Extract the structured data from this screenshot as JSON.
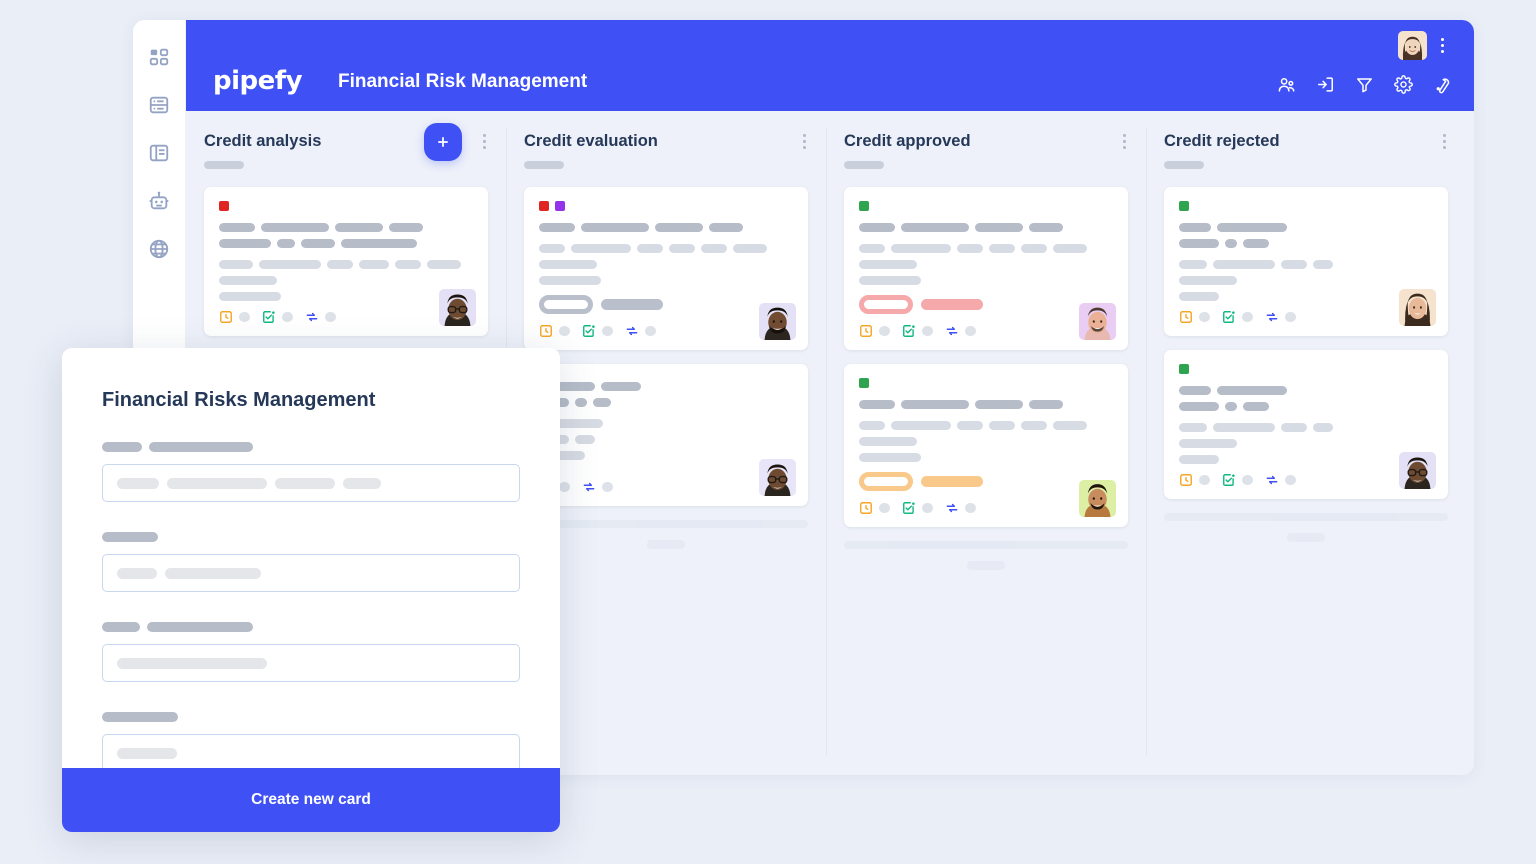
{
  "app": {
    "logo_text": "pipefy",
    "board_title": "Financial Risk Management",
    "accent_color": "#3f51f5",
    "background_color": "#eaeef7",
    "board_background": "#eef1f9"
  },
  "sidebar": {
    "items": [
      {
        "icon": "apps-grid-icon",
        "label": "Apps"
      },
      {
        "icon": "database-icon",
        "label": "Database"
      },
      {
        "icon": "layout-panel-icon",
        "label": "Layout"
      },
      {
        "icon": "robot-automation-icon",
        "label": "Automations"
      },
      {
        "icon": "globe-icon",
        "label": "Portals"
      }
    ]
  },
  "topbar": {
    "avatar": {
      "name": "user-avatar",
      "skin": "#f0d5bd",
      "hair": "#4a3326",
      "bg": "#f6e3cd"
    },
    "kebab": "more-options",
    "actions": [
      {
        "icon": "members-icon",
        "label": "Members"
      },
      {
        "icon": "import-icon",
        "label": "Import"
      },
      {
        "icon": "filter-icon",
        "label": "Filter"
      },
      {
        "icon": "settings-gear-icon",
        "label": "Settings"
      },
      {
        "icon": "wrench-icon",
        "label": "Tools"
      }
    ]
  },
  "board": {
    "columns": [
      {
        "title": "Credit analysis",
        "has_add_button": true,
        "add_label": "+",
        "cards": [
          {
            "dots": [
              "#e02424"
            ],
            "lines_dark": [
              [
                36,
                68,
                48,
                34
              ],
              [
                52,
                18,
                34,
                76
              ]
            ],
            "lines_light": [
              [
                34,
                62,
                26,
                30,
                26,
                34
              ],
              [
                58
              ],
              [
                62
              ]
            ],
            "tag": null,
            "footer_icons": [
              "clock-square-icon",
              "calendar-check-icon",
              "repeat-icon"
            ],
            "avatar": {
              "skin": "#6e4a31",
              "hair": "#1d1510",
              "bg": "#e4e1f6",
              "glasses": true
            }
          }
        ]
      },
      {
        "title": "Credit evaluation",
        "has_add_button": false,
        "cards": [
          {
            "dots": [
              "#e02424",
              "#9333ea"
            ],
            "lines_dark": [
              [
                36,
                68,
                48,
                34
              ]
            ],
            "lines_light": [
              [
                26,
                60,
                26,
                26,
                26,
                34
              ],
              [
                58
              ],
              [
                62
              ]
            ],
            "tag": {
              "color": "#b9c0cc",
              "style": "gray"
            },
            "footer_icons": [
              "clock-square-icon",
              "calendar-check-icon",
              "repeat-icon"
            ],
            "avatar": {
              "skin": "#714c33",
              "hair": "#15100c",
              "bg": "#e4e1f6",
              "beard": true
            }
          },
          {
            "dots": [],
            "lines_dark": [
              [
                56,
                40
              ],
              [
                30,
                12,
                18
              ]
            ],
            "lines_light": [
              [
                64
              ],
              [
                30,
                20
              ],
              [
                46
              ]
            ],
            "tag": null,
            "footer_icons": [
              "calendar-check-icon",
              "repeat-icon"
            ],
            "avatar": {
              "skin": "#6e4a31",
              "hair": "#1d1510",
              "bg": "#e8e5f8",
              "glasses": true
            }
          }
        ]
      },
      {
        "title": "Credit approved",
        "has_add_button": false,
        "cards": [
          {
            "dots": [
              "#2ea44f"
            ],
            "lines_dark": [
              [
                36,
                68,
                48,
                34
              ]
            ],
            "lines_light": [
              [
                26,
                60,
                26,
                26,
                26,
                34
              ],
              [
                58
              ],
              [
                62
              ]
            ],
            "tag": {
              "color": "#f6a9ab",
              "style": "pink"
            },
            "footer_icons": [
              "clock-square-icon",
              "calendar-check-icon",
              "repeat-icon"
            ],
            "avatar": {
              "skin": "#eab197",
              "hair": "#4a3a2c",
              "bg": "#e9cdf3",
              "beard": true
            }
          },
          {
            "dots": [
              "#2ea44f"
            ],
            "lines_dark": [
              [
                36,
                68,
                48,
                34
              ]
            ],
            "lines_light": [
              [
                26,
                60,
                26,
                26,
                26,
                34
              ],
              [
                58
              ],
              [
                62
              ]
            ],
            "tag": {
              "color": "#f8c98a",
              "style": "orange"
            },
            "footer_icons": [
              "clock-square-icon",
              "calendar-check-icon",
              "repeat-icon"
            ],
            "avatar": {
              "skin": "#c98c5f",
              "hair": "#201509",
              "bg": "#dcefa5",
              "beard": true
            }
          }
        ]
      },
      {
        "title": "Credit rejected",
        "has_add_button": false,
        "cards": [
          {
            "dots": [
              "#2ea44f"
            ],
            "lines_dark": [
              [
                32,
                70
              ],
              [
                40,
                12,
                26
              ]
            ],
            "lines_light": [
              [
                28,
                62,
                26,
                20
              ],
              [
                58
              ],
              [
                40
              ]
            ],
            "tag": null,
            "footer_icons": [
              "clock-square-icon",
              "calendar-check-icon",
              "repeat-icon"
            ],
            "avatar": {
              "skin": "#e8b998",
              "hair": "#3b2a1d",
              "bg": "#f6e0c5"
            }
          },
          {
            "dots": [
              "#2ea44f"
            ],
            "lines_dark": [
              [
                32,
                70
              ],
              [
                40,
                12,
                26
              ]
            ],
            "lines_light": [
              [
                28,
                62,
                26,
                20
              ],
              [
                58
              ],
              [
                40
              ]
            ],
            "tag": null,
            "footer_icons": [
              "clock-square-icon",
              "calendar-check-icon",
              "repeat-icon"
            ],
            "avatar": {
              "skin": "#6e4a31",
              "hair": "#1d1510",
              "bg": "#e4e1f6",
              "glasses": true
            }
          }
        ]
      }
    ]
  },
  "modal": {
    "title": "Financial Risks Management",
    "fields": [
      {
        "label_widths": [
          40,
          104
        ],
        "placeholder_widths": [
          42,
          100,
          60,
          38
        ]
      },
      {
        "label_widths": [
          56
        ],
        "placeholder_widths": [
          40,
          96
        ]
      },
      {
        "label_widths": [
          38,
          106
        ],
        "placeholder_widths": [
          150
        ]
      },
      {
        "label_widths": [
          76
        ],
        "placeholder_widths": [
          60
        ]
      }
    ],
    "cta_label": "Create new card"
  }
}
